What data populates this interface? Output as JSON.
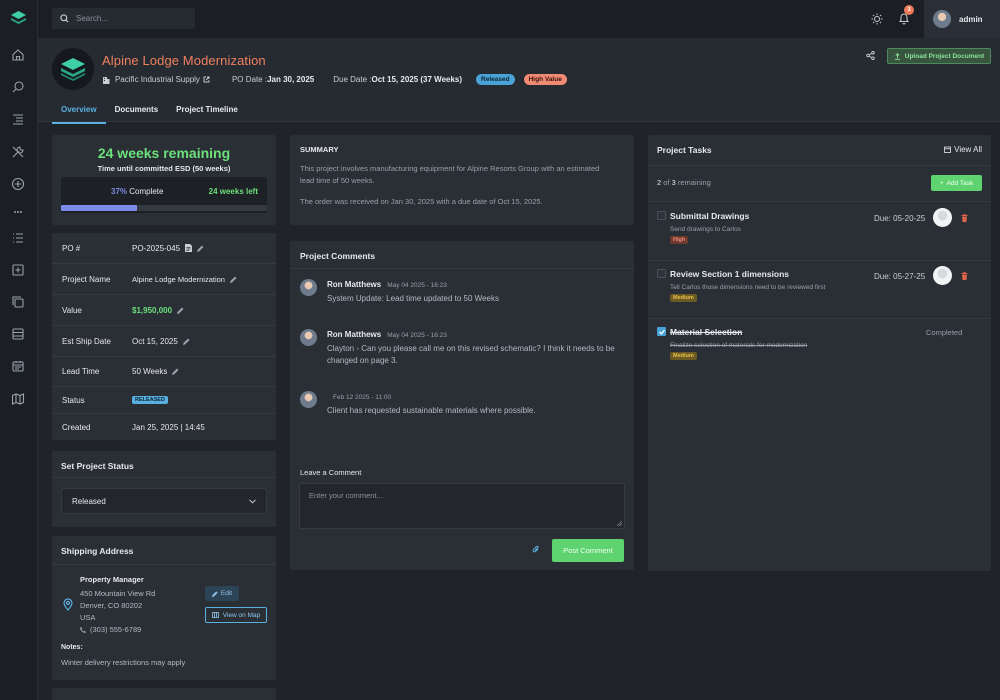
{
  "topbar": {
    "search_placeholder": "Search...",
    "notif_count": "3",
    "username": "admin"
  },
  "header": {
    "title": "Alpine Lodge Modernization",
    "company": "Pacific Industrial Supply",
    "po_date_label": "PO Date : ",
    "po_date": "Jan 30, 2025",
    "due_date_label": "Due Date : ",
    "due_date": "Oct 15, 2025 (37 Weeks)",
    "status_badge": "Released",
    "value_badge": "High Value",
    "upload_label": "Upload Project Document",
    "tabs": [
      "Overview",
      "Documents",
      "Project Timeline"
    ]
  },
  "countdown": {
    "headline": "24 weeks remaining",
    "sub": "Time until committed ESD (50 weeks)",
    "percent_label": "37%",
    "complete_label": " Complete",
    "left_num": "24",
    "left_label": " weeks left",
    "progress": 0.37
  },
  "details": {
    "rows": [
      {
        "k": "PO #",
        "v": "PO-2025-045"
      },
      {
        "k": "Project Name",
        "v": "Alpine Lodge Modernization"
      },
      {
        "k": "Value",
        "v": "$1,950,000"
      },
      {
        "k": "Est Ship Date",
        "v": "Oct 15, 2025"
      },
      {
        "k": "Lead Time",
        "v": "50 Weeks"
      },
      {
        "k": "Status",
        "v": "RELEASED"
      },
      {
        "k": "Created",
        "v": "Jan 25, 2025 | 14:45"
      }
    ]
  },
  "set_status": {
    "title": "Set Project Status",
    "selected": "Released"
  },
  "shipping": {
    "title": "Shipping Address",
    "contact": "Property Manager",
    "line1": "450 Mountain View Rd",
    "line2": "Denver, CO 80202",
    "line3": "USA",
    "phone": "(303) 555-6789",
    "edit": "Edit",
    "map": "View on Map",
    "notes_label": "Notes:",
    "notes": "Winter delivery restrictions may apply"
  },
  "summary": {
    "title": "SUMMARY",
    "p1": "This project involves manufacturing equipment for Alpine Resorts Group with an estimated lead time of 50 weeks.",
    "p2": "The order was received on Jan 30, 2025 with a due date of Oct 15, 2025."
  },
  "comments": {
    "title": "Project Comments",
    "items": [
      {
        "name": "Ron Matthews",
        "date": "May 04 2025 - 16:23",
        "text": "System Update: Lead time updated to 50 Weeks"
      },
      {
        "name": "Ron Matthews",
        "date": "May 04 2025 - 16:23",
        "text": "Clayton - Can you please call me on this revised schematic? I think it needs to be changed on page 3."
      },
      {
        "name": "",
        "date": "Feb 12 2025 - 11:00",
        "text": "Client has requested sustainable materials where possible."
      }
    ],
    "leave_label": "Leave a Comment",
    "placeholder": "Enter your comment...",
    "post": "Post Comment"
  },
  "tasks": {
    "title": "Project Tasks",
    "view_all": "View All",
    "remaining_num": "2",
    "remaining_text": " of ",
    "remaining_total": "3",
    "remaining_suffix": " remaining",
    "add": "Add Task",
    "items": [
      {
        "title": "Submittal Drawings",
        "sub": "Send drawings to Carlos",
        "prio": "High",
        "due": "Due: 05-20-25"
      },
      {
        "title": "Review Section 1 dimensions",
        "sub": "Tell Carlos those dimensions need to be reviewed first",
        "prio": "Medium",
        "due": "Due: 05-27-25"
      },
      {
        "title": "Material Selection",
        "sub": "Finalize selection of materials for modernization",
        "prio": "Medium",
        "status": "Completed"
      }
    ]
  }
}
